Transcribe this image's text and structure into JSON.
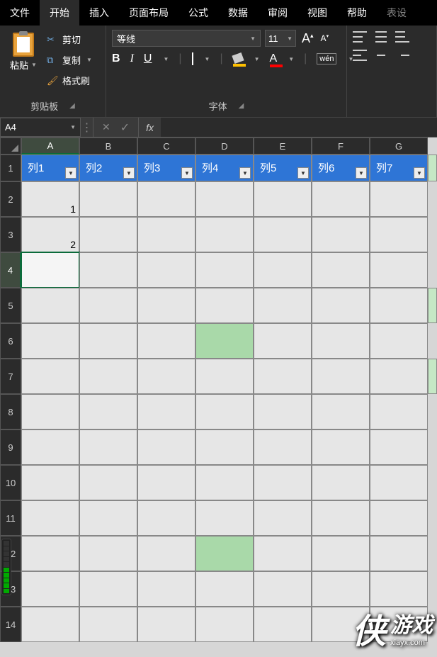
{
  "tabs": {
    "file": "文件",
    "home": "开始",
    "insert": "插入",
    "layout": "页面布局",
    "formula": "公式",
    "data": "数据",
    "review": "审阅",
    "view": "视图",
    "help": "帮助",
    "tool": "表设"
  },
  "clipboard": {
    "paste": "粘贴",
    "cut": "剪切",
    "copy": "复制",
    "brush": "格式刷",
    "group": "剪贴板"
  },
  "font": {
    "name": "等线",
    "size": "11",
    "bold": "B",
    "italic": "I",
    "underline": "U",
    "fontcolor_letter": "A",
    "wen": "wén",
    "group": "字体"
  },
  "namebox": "A4",
  "fx": "fx",
  "columns": [
    "A",
    "B",
    "C",
    "D",
    "E",
    "F",
    "G"
  ],
  "rows": [
    "1",
    "2",
    "3",
    "4",
    "5",
    "6",
    "7",
    "8",
    "9",
    "10",
    "11",
    "12",
    "13",
    "14"
  ],
  "table_headers": [
    "列1",
    "列2",
    "列3",
    "列4",
    "列5",
    "列6",
    "列7"
  ],
  "data_cells": {
    "r2_a": "1",
    "r3_a": "2"
  },
  "active_cell": "A4",
  "watermark": {
    "brand": "侠",
    "text": "游戏",
    "url": "xiayx.com"
  }
}
